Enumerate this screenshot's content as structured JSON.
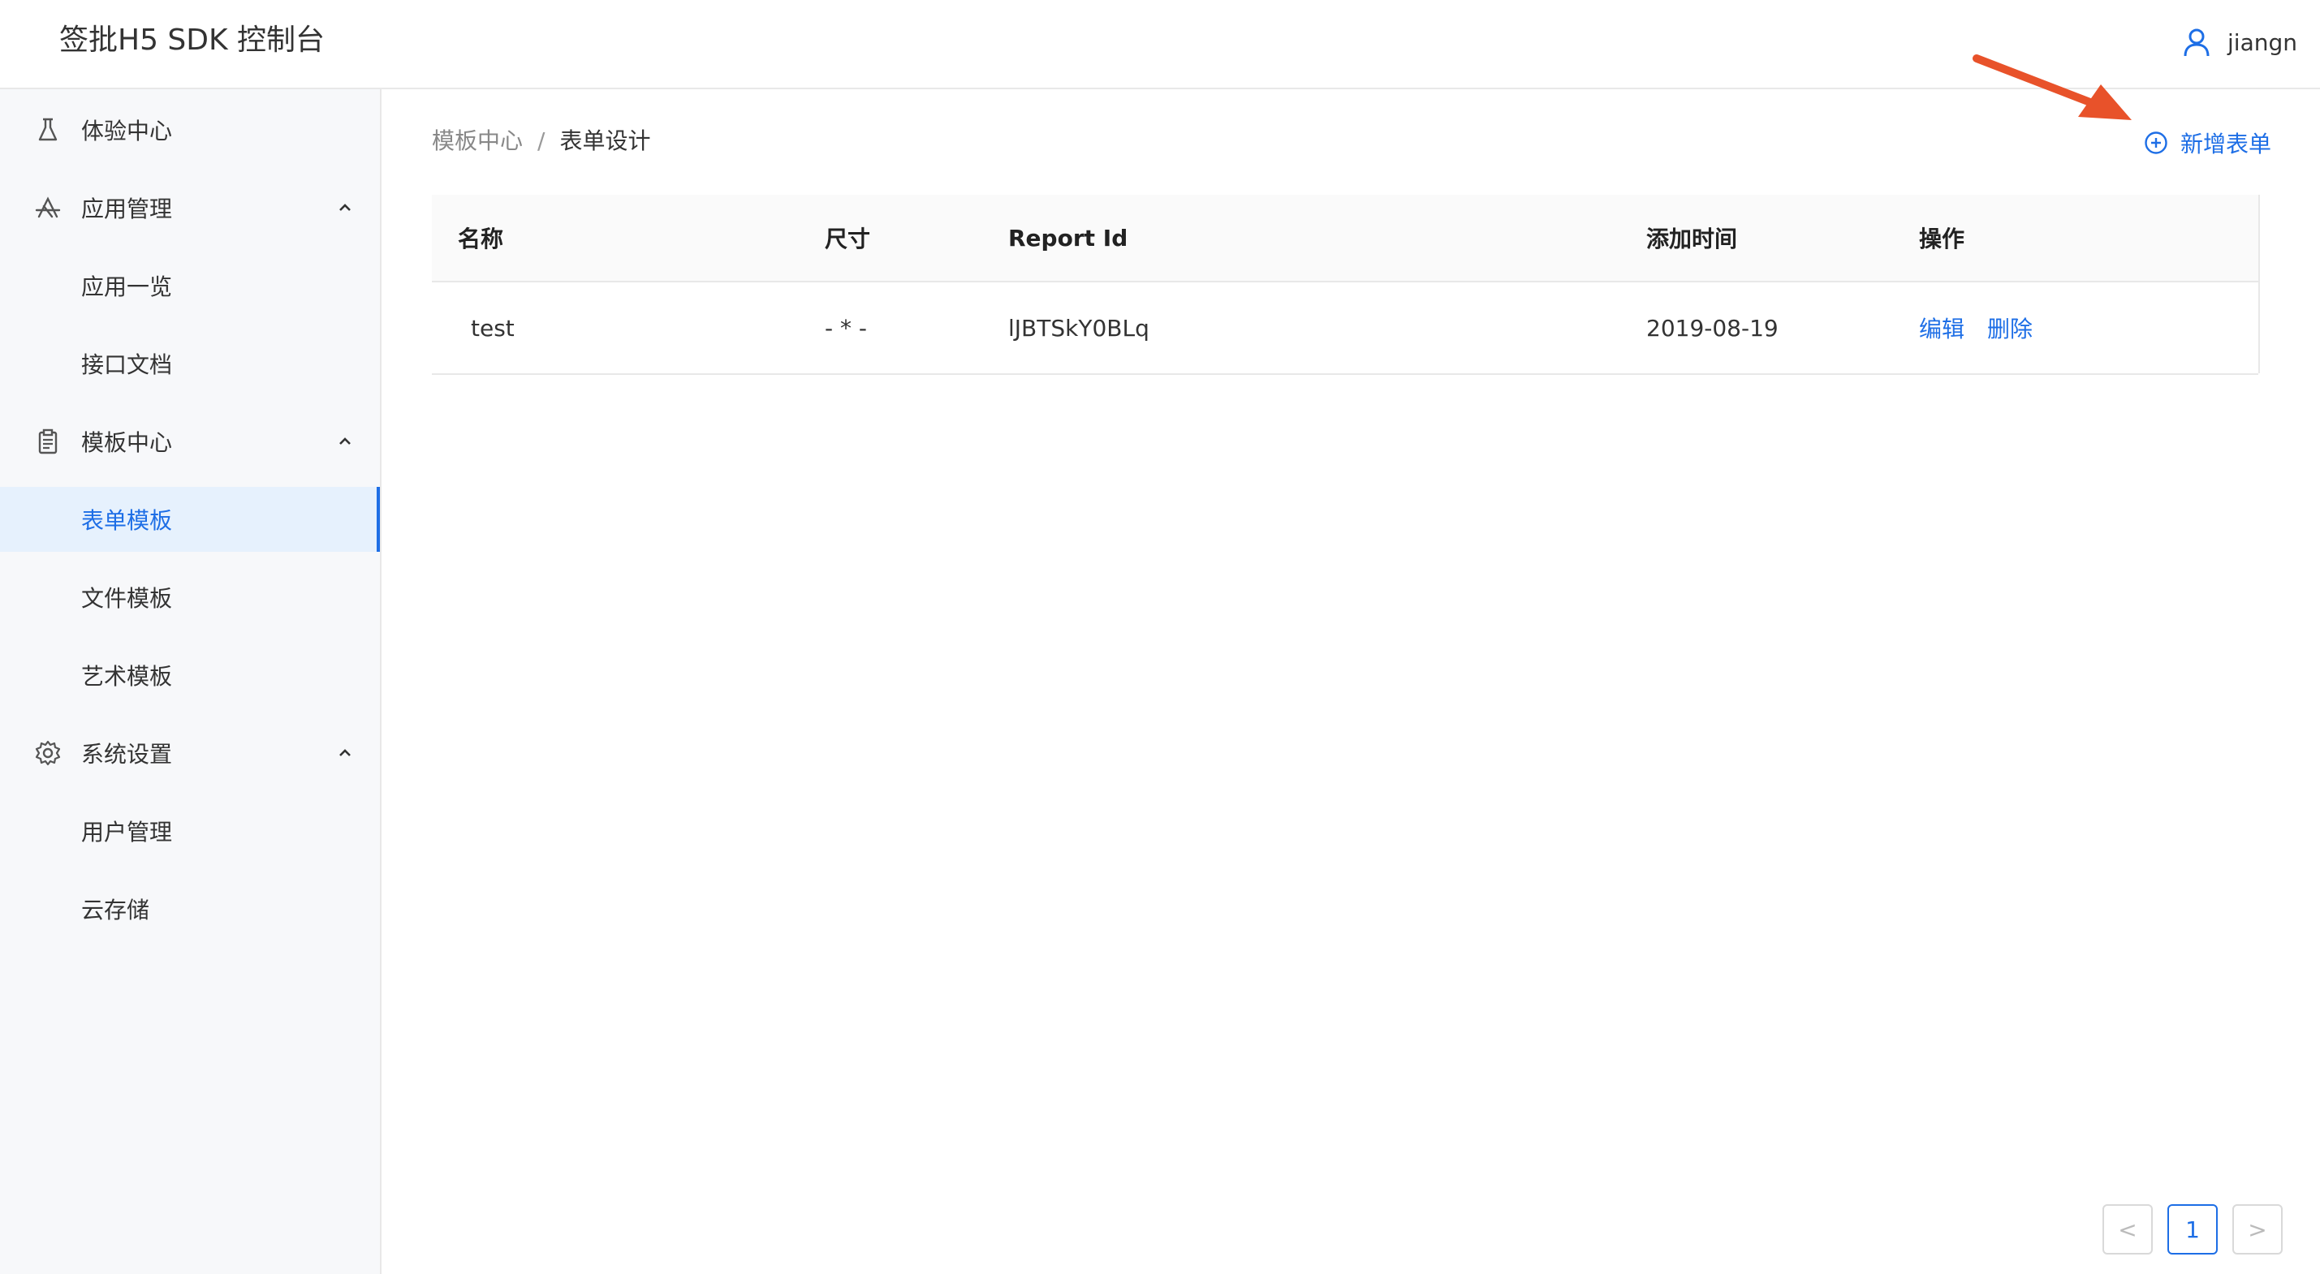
{
  "header": {
    "title": "签批H5 SDK 控制台",
    "user_name": "jiangn"
  },
  "sidebar": {
    "items": [
      {
        "label": "体验中心",
        "icon": "flask-icon"
      },
      {
        "label": "应用管理",
        "icon": "app-store-icon",
        "expanded": true
      },
      {
        "label": "应用一览"
      },
      {
        "label": "接口文档"
      },
      {
        "label": "模板中心",
        "icon": "clipboard-icon",
        "expanded": true
      },
      {
        "label": "表单模板",
        "active": true
      },
      {
        "label": "文件模板"
      },
      {
        "label": "艺术模板"
      },
      {
        "label": "系统设置",
        "icon": "gear-icon",
        "expanded": true
      },
      {
        "label": "用户管理"
      },
      {
        "label": "云存储"
      }
    ]
  },
  "breadcrumb": {
    "parent": "模板中心",
    "separator": "/",
    "current": "表单设计"
  },
  "toolbar": {
    "add_label": "新增表单"
  },
  "table": {
    "columns": [
      "名称",
      "尺寸",
      "Report Id",
      "添加时间",
      "操作"
    ],
    "rows": [
      {
        "name": "test",
        "size": "- * -",
        "report_id": "lJBTSkY0BLq",
        "added": "2019-08-19",
        "actions": [
          "编辑",
          "删除"
        ]
      }
    ]
  },
  "pagination": {
    "prev": "<",
    "current": "1",
    "next": ">"
  },
  "colors": {
    "accent": "#1d6ee6",
    "annotation_arrow": "#e8522a",
    "sidebar_bg": "#f7f8fa"
  }
}
